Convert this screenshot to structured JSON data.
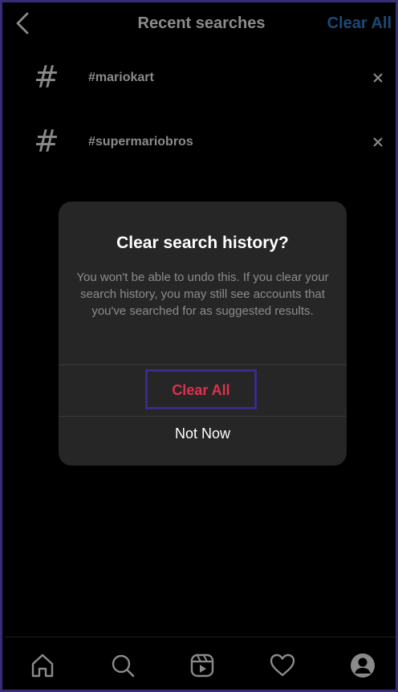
{
  "header": {
    "title": "Recent searches",
    "clear_all_label": "Clear All"
  },
  "recent": [
    {
      "tag": "#mariokart",
      "icon": "hashtag-icon"
    },
    {
      "tag": "#supermariobros",
      "icon": "hashtag-icon"
    }
  ],
  "dialog": {
    "title": "Clear search history?",
    "body": "You won't be able to undo this. If you clear your search history, you may still see accounts that you've searched for as suggested results.",
    "clear_label": "Clear All",
    "not_now_label": "Not Now"
  },
  "nav": {
    "items": [
      "home-icon",
      "search-icon",
      "reels-icon",
      "heart-icon",
      "profile-icon"
    ]
  },
  "colors": {
    "background": "#000000",
    "dialog": "#262626",
    "destructive": "#e0304c",
    "highlight_border": "#3b2a8c",
    "link": "#1a4a78"
  }
}
